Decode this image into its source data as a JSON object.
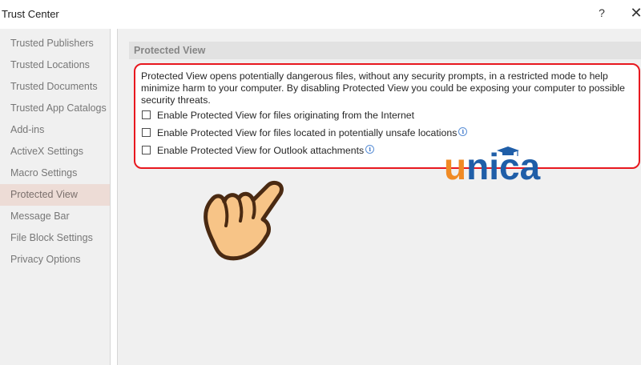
{
  "window": {
    "title": "Trust Center",
    "help_label": "?",
    "close_label": "✕"
  },
  "sidebar": {
    "items": [
      {
        "label": "Trusted Publishers"
      },
      {
        "label": "Trusted Locations"
      },
      {
        "label": "Trusted Documents"
      },
      {
        "label": "Trusted App Catalogs"
      },
      {
        "label": "Add-ins"
      },
      {
        "label": "ActiveX Settings"
      },
      {
        "label": "Macro Settings"
      },
      {
        "label": "Protected View",
        "selected": true
      },
      {
        "label": "Message Bar"
      },
      {
        "label": "File Block Settings"
      },
      {
        "label": "Privacy Options"
      }
    ]
  },
  "main": {
    "section_title": "Protected View",
    "description": "Protected View opens potentially dangerous files, without any security prompts, in a restricted mode to help minimize harm to your computer. By disabling Protected View you could be exposing your computer to possible security threats.",
    "options": [
      {
        "label": "Enable Protected View for files originating from the Internet",
        "checked": false,
        "info_icon": false
      },
      {
        "label": "Enable Protected View for files located in potentially unsafe locations",
        "checked": false,
        "info_icon": true
      },
      {
        "label": "Enable Protected View for Outlook attachments",
        "checked": false,
        "info_icon": true
      }
    ],
    "info_glyph": "i"
  },
  "overlay": {
    "highlight_color": "#e8181f",
    "watermark_text": "unica",
    "watermark_colors": {
      "u": "#f08a24",
      "nica": "#1f5ea8"
    },
    "pointer_icon": "pointing-hand-icon"
  }
}
